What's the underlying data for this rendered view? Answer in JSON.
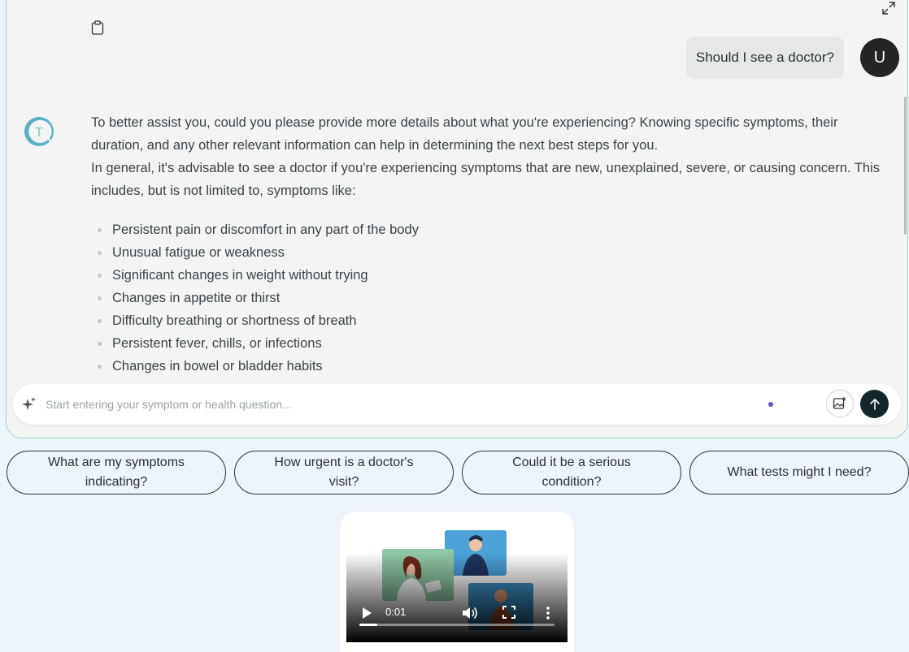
{
  "chat": {
    "user_message": "Should I see a doctor?",
    "user_initial": "U",
    "bot_initial": "T",
    "bot_paragraphs": [
      "To better assist you, could you please provide more details about what you're experiencing? Knowing specific symptoms, their duration, and any other relevant information can help in determining the next best steps for you.",
      "In general, it's advisable to see a doctor if you're experiencing symptoms that are new, unexplained, severe, or causing concern. This includes, but is not limited to, symptoms like:"
    ],
    "bullets": [
      "Persistent pain or discomfort in any part of the body",
      "Unusual fatigue or weakness",
      "Significant changes in weight without trying",
      "Changes in appetite or thirst",
      "Difficulty breathing or shortness of breath",
      "Persistent fever, chills, or infections",
      "Changes in bowel or bladder habits"
    ]
  },
  "input": {
    "placeholder": "Start entering your symptom or health question..."
  },
  "suggestions": [
    "What are my symptoms indicating?",
    "How urgent is a doctor's visit?",
    "Could it be a serious condition?",
    "What tests might I need?"
  ],
  "video": {
    "time": "0:01",
    "progress": 0.09
  },
  "colors": {
    "panel_border": "#9fd4c2",
    "send_button": "#13262c",
    "bot_avatar": "#5fb0c2",
    "status_dot": "#6a4fc2"
  },
  "icons": [
    "expand-icon",
    "clipboard-icon",
    "sparkle-icon",
    "image-add-icon",
    "arrow-up-icon",
    "play-icon",
    "volume-icon",
    "fullscreen-icon",
    "more-vertical-icon"
  ]
}
